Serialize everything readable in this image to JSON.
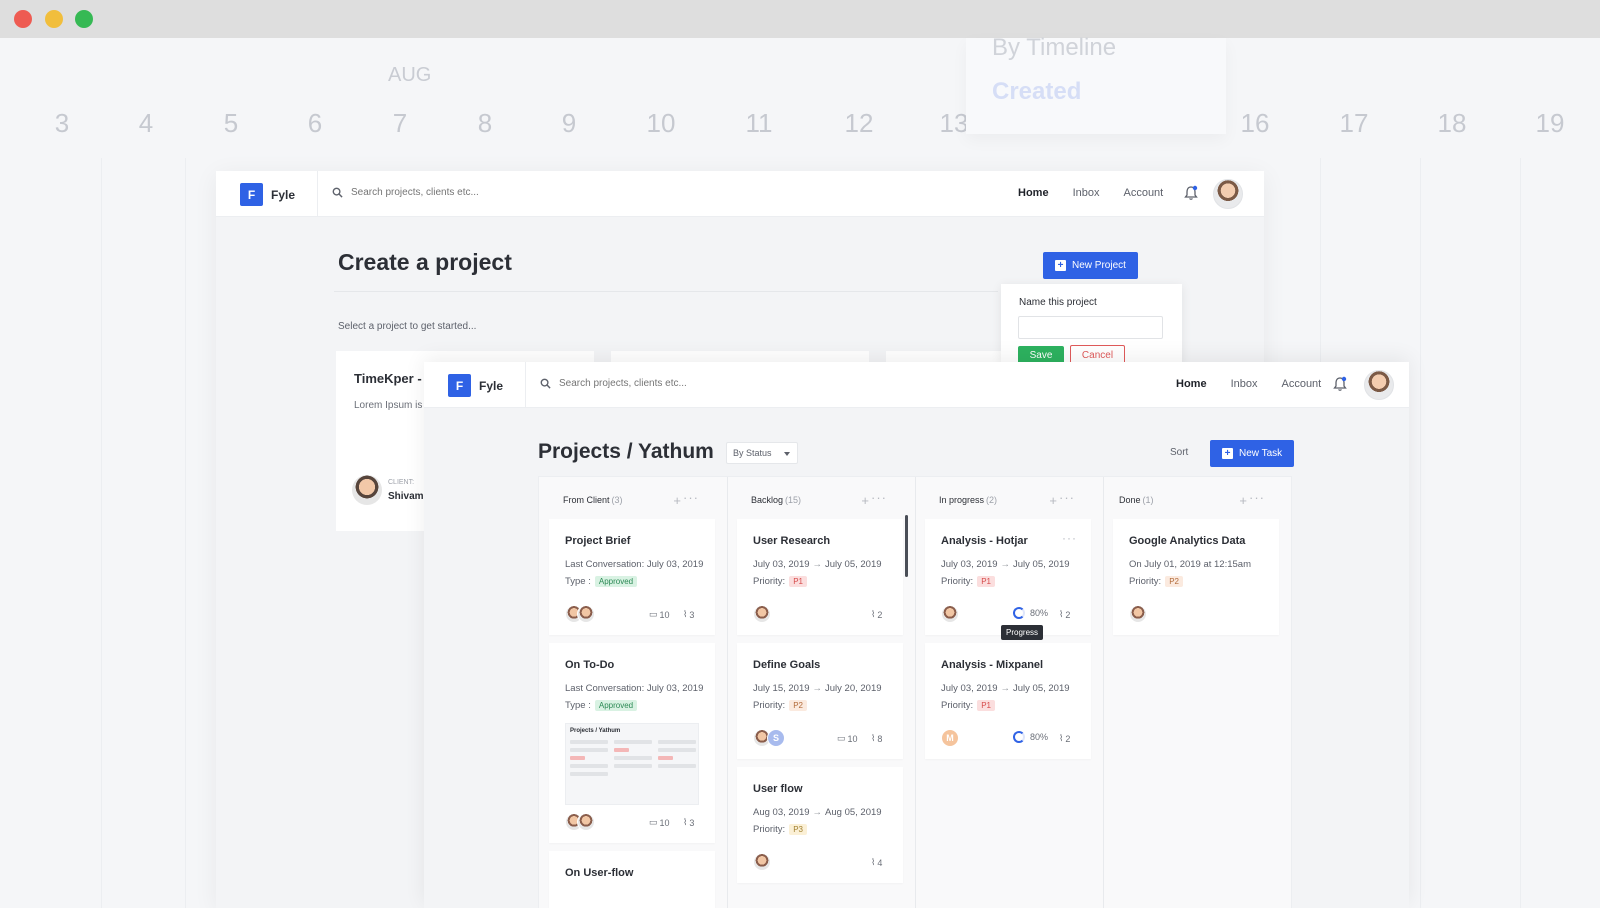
{
  "background": {
    "month": "AUG",
    "days": [
      "3",
      "4",
      "5",
      "6",
      "7",
      "8",
      "9",
      "10",
      "11",
      "12",
      "13",
      "16",
      "17",
      "18",
      "19"
    ],
    "dropdown_items": [
      "By Timeline",
      "Created"
    ]
  },
  "window1": {
    "brand": {
      "logo": "F",
      "name": "Fyle"
    },
    "search_placeholder": "Search projects, clients etc...",
    "nav": {
      "home": "Home",
      "inbox": "Inbox",
      "account": "Account"
    },
    "title": "Create a project",
    "subtitle": "Select a project to get started...",
    "new_project_button": "New Project",
    "popover": {
      "label": "Name this project",
      "input_value": "",
      "save": "Save",
      "cancel": "Cancel"
    },
    "project_card": {
      "title": "TimeKper -",
      "description": "Lorem Ipsum is printing and typ text of the.",
      "client_label": "CLIENT:",
      "client_name": "Shivam"
    }
  },
  "window2": {
    "brand": {
      "logo": "F",
      "name": "Fyle"
    },
    "search_placeholder": "Search projects, clients etc...",
    "nav": {
      "home": "Home",
      "inbox": "Inbox",
      "account": "Account"
    },
    "title": "Projects / Yathum",
    "filter": "By Status",
    "sort": "Sort",
    "new_task_button": "New Task",
    "columns": [
      {
        "name": "From Client",
        "count": "(3)"
      },
      {
        "name": "Backlog",
        "count": "(15)"
      },
      {
        "name": "In progress",
        "count": "(2)"
      },
      {
        "name": "Done",
        "count": "(1)"
      }
    ],
    "cards": {
      "project_brief": {
        "title": "Project Brief",
        "line1": "Last Conversation: July 03, 2019",
        "type_label": "Type :",
        "tag": "Approved",
        "comments": "10",
        "attachments": "3"
      },
      "on_todo": {
        "title": "On To-Do",
        "line1": "Last Conversation: July 03, 2019",
        "type_label": "Type :",
        "tag": "Approved",
        "thumb_title": "Projects / Yathum",
        "comments": "10",
        "attachments": "3"
      },
      "on_userflow": {
        "title": "On User-flow"
      },
      "user_research": {
        "title": "User Research",
        "start": "July 03, 2019",
        "end": "July 05, 2019",
        "priority_label": "Priority:",
        "priority": "P1",
        "attachments": "2"
      },
      "define_goals": {
        "title": "Define Goals",
        "start": "July 15, 2019",
        "end": "July 20, 2019",
        "priority_label": "Priority:",
        "priority": "P2",
        "avatar_letter": "S",
        "comments": "10",
        "attachments": "8"
      },
      "user_flow": {
        "title": "User flow",
        "start": "Aug 03, 2019",
        "end": "Aug 05, 2019",
        "priority_label": "Priority:",
        "priority": "P3",
        "attachments": "4"
      },
      "analysis_hotjar": {
        "title": "Analysis - Hotjar",
        "start": "July 03, 2019",
        "end": "July 05, 2019",
        "priority_label": "Priority:",
        "priority": "P1",
        "progress": "80%",
        "attachments": "2",
        "tooltip": "Progress"
      },
      "analysis_mixpanel": {
        "title": "Analysis - Mixpanel",
        "start": "July 03, 2019",
        "end": "July 05, 2019",
        "priority_label": "Priority:",
        "priority": "P1",
        "avatar_letter": "M",
        "progress": "80%",
        "attachments": "2"
      },
      "google_analytics": {
        "title": "Google Analytics Data",
        "line1": "On July 01, 2019 at 12:15am",
        "priority_label": "Priority:",
        "priority": "P2"
      }
    }
  }
}
